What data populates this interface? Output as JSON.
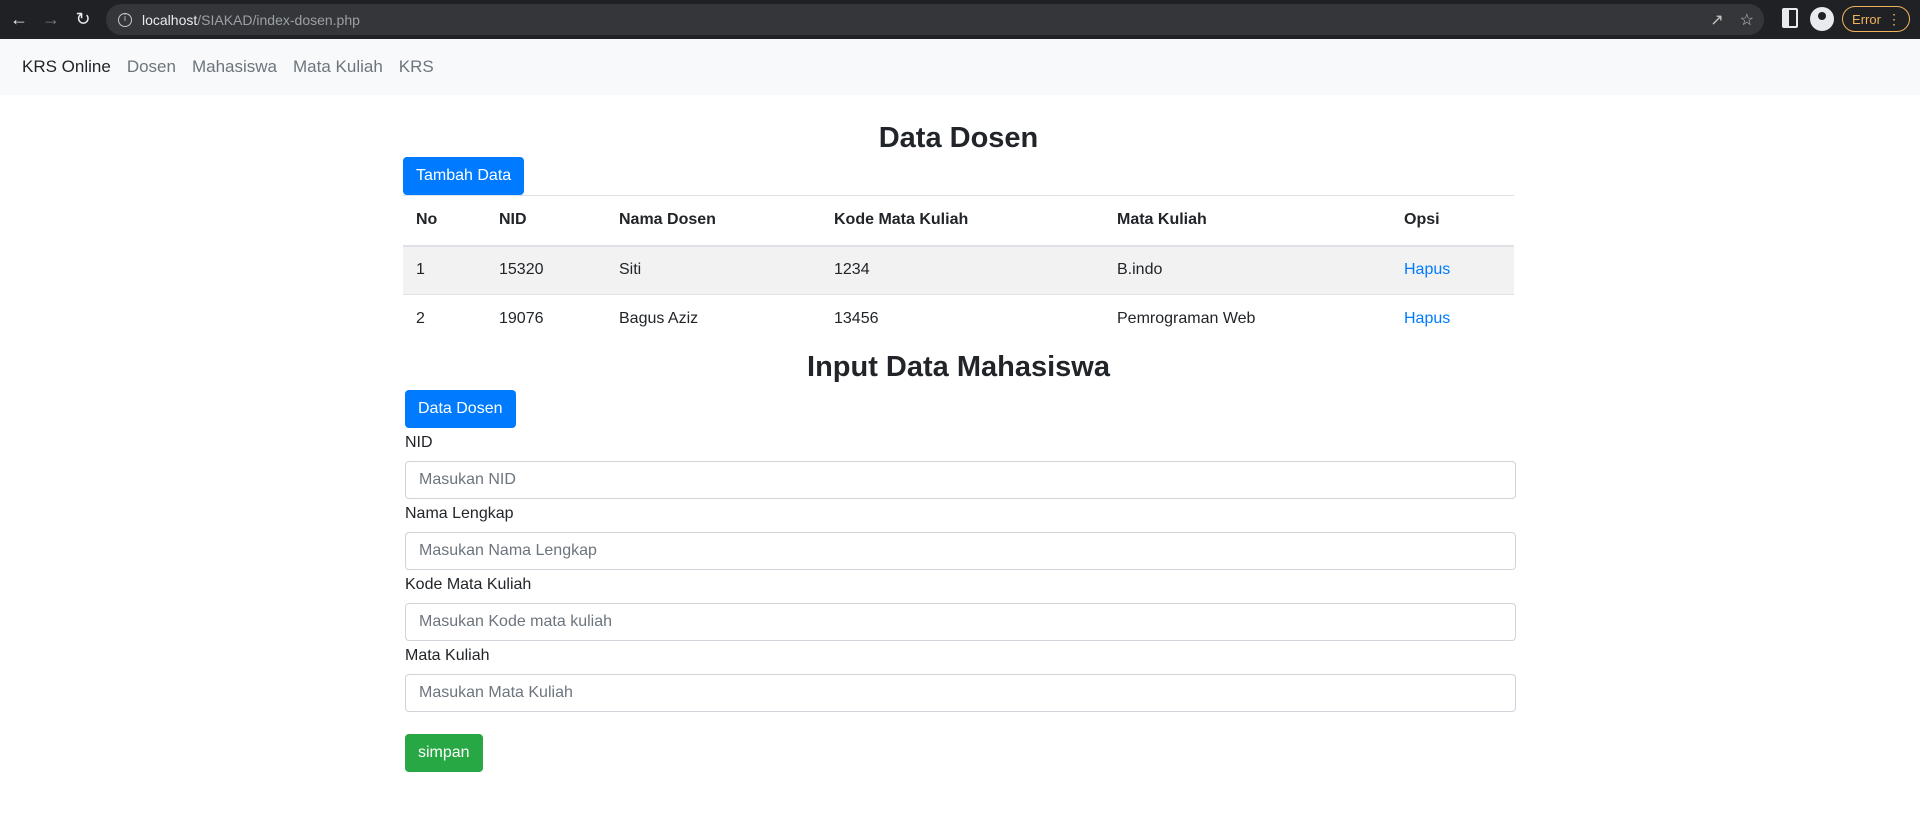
{
  "browser": {
    "url_host": "localhost",
    "url_path": "/SIAKAD/index-dosen.php",
    "error_chip": "Error"
  },
  "navbar": {
    "brand": "KRS Online",
    "links": [
      "Dosen",
      "Mahasiswa",
      "Mata Kuliah",
      "KRS"
    ]
  },
  "dosen_section": {
    "title": "Data Dosen",
    "add_button": "Tambah Data",
    "columns": [
      "No",
      "NID",
      "Nama Dosen",
      "Kode Mata Kuliah",
      "Mata Kuliah",
      "Opsi"
    ],
    "rows": [
      {
        "no": "1",
        "nid": "15320",
        "nama": "Siti",
        "kode": "1234",
        "matkul": "B.indo",
        "opsi": "Hapus"
      },
      {
        "no": "2",
        "nid": "19076",
        "nama": "Bagus Aziz",
        "kode": "13456",
        "matkul": "Pemrograman Web",
        "opsi": "Hapus"
      }
    ]
  },
  "input_section": {
    "title": "Input Data Mahasiswa",
    "data_button": "Data Dosen",
    "fields": [
      {
        "label": "NID",
        "placeholder": "Masukan NID"
      },
      {
        "label": "Nama Lengkap",
        "placeholder": "Masukan Nama Lengkap"
      },
      {
        "label": "Kode Mata Kuliah",
        "placeholder": "Masukan Kode mata kuliah"
      },
      {
        "label": "Mata Kuliah",
        "placeholder": "Masukan Mata Kuliah"
      }
    ],
    "submit_button": "simpan"
  },
  "colors": {
    "primary": "#007bff",
    "success": "#28a745",
    "navbar_bg": "#f8f9fa",
    "chrome_bg": "#202124"
  }
}
